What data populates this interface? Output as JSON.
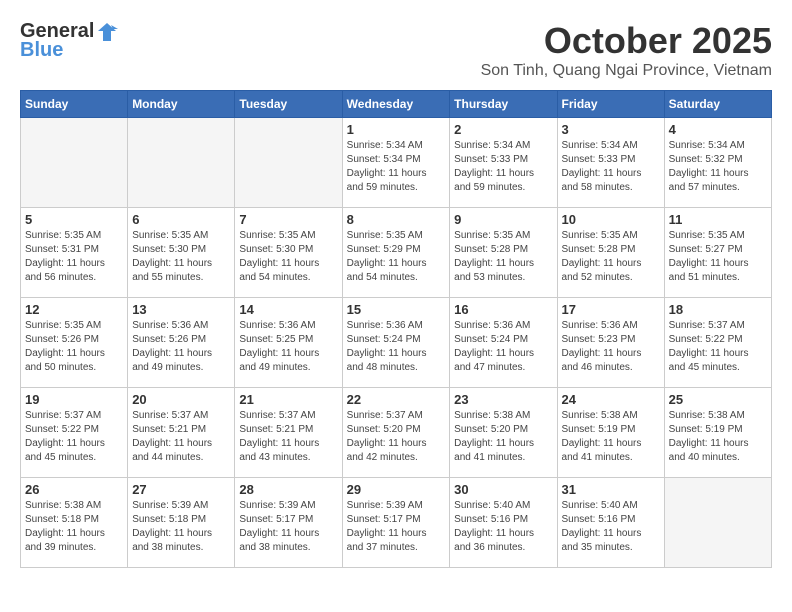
{
  "header": {
    "logo_general": "General",
    "logo_blue": "Blue",
    "month": "October 2025",
    "location": "Son Tinh, Quang Ngai Province, Vietnam"
  },
  "weekdays": [
    "Sunday",
    "Monday",
    "Tuesday",
    "Wednesday",
    "Thursday",
    "Friday",
    "Saturday"
  ],
  "weeks": [
    [
      {
        "day": "",
        "info": ""
      },
      {
        "day": "",
        "info": ""
      },
      {
        "day": "",
        "info": ""
      },
      {
        "day": "1",
        "info": "Sunrise: 5:34 AM\nSunset: 5:34 PM\nDaylight: 11 hours\nand 59 minutes."
      },
      {
        "day": "2",
        "info": "Sunrise: 5:34 AM\nSunset: 5:33 PM\nDaylight: 11 hours\nand 59 minutes."
      },
      {
        "day": "3",
        "info": "Sunrise: 5:34 AM\nSunset: 5:33 PM\nDaylight: 11 hours\nand 58 minutes."
      },
      {
        "day": "4",
        "info": "Sunrise: 5:34 AM\nSunset: 5:32 PM\nDaylight: 11 hours\nand 57 minutes."
      }
    ],
    [
      {
        "day": "5",
        "info": "Sunrise: 5:35 AM\nSunset: 5:31 PM\nDaylight: 11 hours\nand 56 minutes."
      },
      {
        "day": "6",
        "info": "Sunrise: 5:35 AM\nSunset: 5:30 PM\nDaylight: 11 hours\nand 55 minutes."
      },
      {
        "day": "7",
        "info": "Sunrise: 5:35 AM\nSunset: 5:30 PM\nDaylight: 11 hours\nand 54 minutes."
      },
      {
        "day": "8",
        "info": "Sunrise: 5:35 AM\nSunset: 5:29 PM\nDaylight: 11 hours\nand 54 minutes."
      },
      {
        "day": "9",
        "info": "Sunrise: 5:35 AM\nSunset: 5:28 PM\nDaylight: 11 hours\nand 53 minutes."
      },
      {
        "day": "10",
        "info": "Sunrise: 5:35 AM\nSunset: 5:28 PM\nDaylight: 11 hours\nand 52 minutes."
      },
      {
        "day": "11",
        "info": "Sunrise: 5:35 AM\nSunset: 5:27 PM\nDaylight: 11 hours\nand 51 minutes."
      }
    ],
    [
      {
        "day": "12",
        "info": "Sunrise: 5:35 AM\nSunset: 5:26 PM\nDaylight: 11 hours\nand 50 minutes."
      },
      {
        "day": "13",
        "info": "Sunrise: 5:36 AM\nSunset: 5:26 PM\nDaylight: 11 hours\nand 49 minutes."
      },
      {
        "day": "14",
        "info": "Sunrise: 5:36 AM\nSunset: 5:25 PM\nDaylight: 11 hours\nand 49 minutes."
      },
      {
        "day": "15",
        "info": "Sunrise: 5:36 AM\nSunset: 5:24 PM\nDaylight: 11 hours\nand 48 minutes."
      },
      {
        "day": "16",
        "info": "Sunrise: 5:36 AM\nSunset: 5:24 PM\nDaylight: 11 hours\nand 47 minutes."
      },
      {
        "day": "17",
        "info": "Sunrise: 5:36 AM\nSunset: 5:23 PM\nDaylight: 11 hours\nand 46 minutes."
      },
      {
        "day": "18",
        "info": "Sunrise: 5:37 AM\nSunset: 5:22 PM\nDaylight: 11 hours\nand 45 minutes."
      }
    ],
    [
      {
        "day": "19",
        "info": "Sunrise: 5:37 AM\nSunset: 5:22 PM\nDaylight: 11 hours\nand 45 minutes."
      },
      {
        "day": "20",
        "info": "Sunrise: 5:37 AM\nSunset: 5:21 PM\nDaylight: 11 hours\nand 44 minutes."
      },
      {
        "day": "21",
        "info": "Sunrise: 5:37 AM\nSunset: 5:21 PM\nDaylight: 11 hours\nand 43 minutes."
      },
      {
        "day": "22",
        "info": "Sunrise: 5:37 AM\nSunset: 5:20 PM\nDaylight: 11 hours\nand 42 minutes."
      },
      {
        "day": "23",
        "info": "Sunrise: 5:38 AM\nSunset: 5:20 PM\nDaylight: 11 hours\nand 41 minutes."
      },
      {
        "day": "24",
        "info": "Sunrise: 5:38 AM\nSunset: 5:19 PM\nDaylight: 11 hours\nand 41 minutes."
      },
      {
        "day": "25",
        "info": "Sunrise: 5:38 AM\nSunset: 5:19 PM\nDaylight: 11 hours\nand 40 minutes."
      }
    ],
    [
      {
        "day": "26",
        "info": "Sunrise: 5:38 AM\nSunset: 5:18 PM\nDaylight: 11 hours\nand 39 minutes."
      },
      {
        "day": "27",
        "info": "Sunrise: 5:39 AM\nSunset: 5:18 PM\nDaylight: 11 hours\nand 38 minutes."
      },
      {
        "day": "28",
        "info": "Sunrise: 5:39 AM\nSunset: 5:17 PM\nDaylight: 11 hours\nand 38 minutes."
      },
      {
        "day": "29",
        "info": "Sunrise: 5:39 AM\nSunset: 5:17 PM\nDaylight: 11 hours\nand 37 minutes."
      },
      {
        "day": "30",
        "info": "Sunrise: 5:40 AM\nSunset: 5:16 PM\nDaylight: 11 hours\nand 36 minutes."
      },
      {
        "day": "31",
        "info": "Sunrise: 5:40 AM\nSunset: 5:16 PM\nDaylight: 11 hours\nand 35 minutes."
      },
      {
        "day": "",
        "info": ""
      }
    ]
  ]
}
